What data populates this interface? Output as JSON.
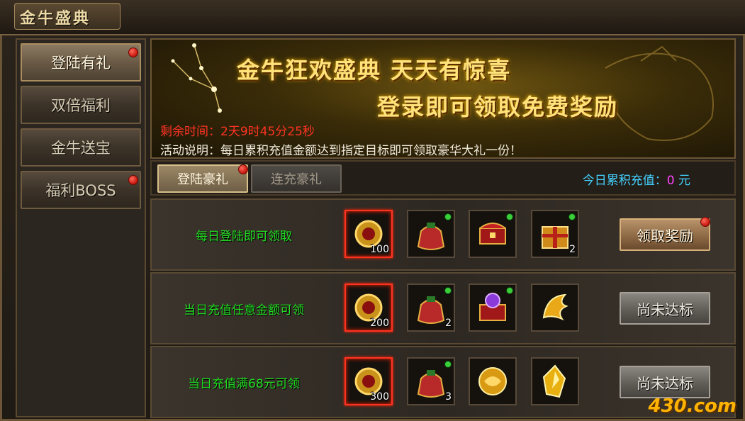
{
  "window": {
    "title": "金牛盛典"
  },
  "sidebar": {
    "items": [
      {
        "label": "登陆有礼",
        "active": true,
        "badge": true
      },
      {
        "label": "双倍福利",
        "active": false,
        "badge": false
      },
      {
        "label": "金牛送宝",
        "active": false,
        "badge": false
      },
      {
        "label": "福利BOSS",
        "active": false,
        "badge": true
      }
    ]
  },
  "banner": {
    "headline1": "金牛狂欢盛典  天天有惊喜",
    "headline2": "登录即可领取免费奖励",
    "timer_label": "剩余时间：",
    "timer_value": "2天9时45分25秒",
    "desc_label": "活动说明：",
    "desc_text": "每日累积充值金额达到指定目标即可领取豪华大礼一份！"
  },
  "tabs": [
    {
      "label": "登陆豪礼",
      "active": true,
      "badge": true
    },
    {
      "label": "连充豪礼",
      "active": false,
      "badge": false
    }
  ],
  "today_recharge": {
    "label": "今日累积充值：",
    "value": "0",
    "unit": "元"
  },
  "rewards": [
    {
      "condition": "每日登陆即可领取",
      "items": [
        {
          "icon": "gold-coin-icon",
          "count": "100",
          "rare": true,
          "new": false
        },
        {
          "icon": "lucky-bag-icon",
          "count": "",
          "rare": false,
          "new": true
        },
        {
          "icon": "treasure-chest-icon",
          "count": "",
          "rare": false,
          "new": true
        },
        {
          "icon": "gift-box-icon",
          "count": "2",
          "rare": false,
          "new": true
        }
      ],
      "button": "领取奖励",
      "button_state": "claim",
      "button_badge": true
    },
    {
      "condition": "当日充值任意金额可领",
      "items": [
        {
          "icon": "gold-coin-icon",
          "count": "200",
          "rare": true,
          "new": false
        },
        {
          "icon": "lucky-bag-icon",
          "count": "2",
          "rare": false,
          "new": true
        },
        {
          "icon": "gem-chest-icon",
          "count": "",
          "rare": false,
          "new": true
        },
        {
          "icon": "gold-wing-icon",
          "count": "",
          "rare": false,
          "new": false
        }
      ],
      "button": "尚未达标",
      "button_state": "disabled",
      "button_badge": false
    },
    {
      "condition": "当日充值满68元可领",
      "items": [
        {
          "icon": "gold-coin-icon",
          "count": "300",
          "rare": true,
          "new": false
        },
        {
          "icon": "lucky-bag-icon",
          "count": "3",
          "rare": false,
          "new": true
        },
        {
          "icon": "gold-orb-icon",
          "count": "",
          "rare": false,
          "new": false
        },
        {
          "icon": "gold-crystal-icon",
          "count": "",
          "rare": false,
          "new": false
        }
      ],
      "button": "尚未达标",
      "button_state": "disabled",
      "button_badge": false
    }
  ],
  "watermark": "430.com",
  "colors": {
    "condition_text": "#22dd22",
    "timer": "#ff3322",
    "today_label": "#44d0ff",
    "today_value": "#ff44ff",
    "banner_gold": "#ffe27a"
  }
}
